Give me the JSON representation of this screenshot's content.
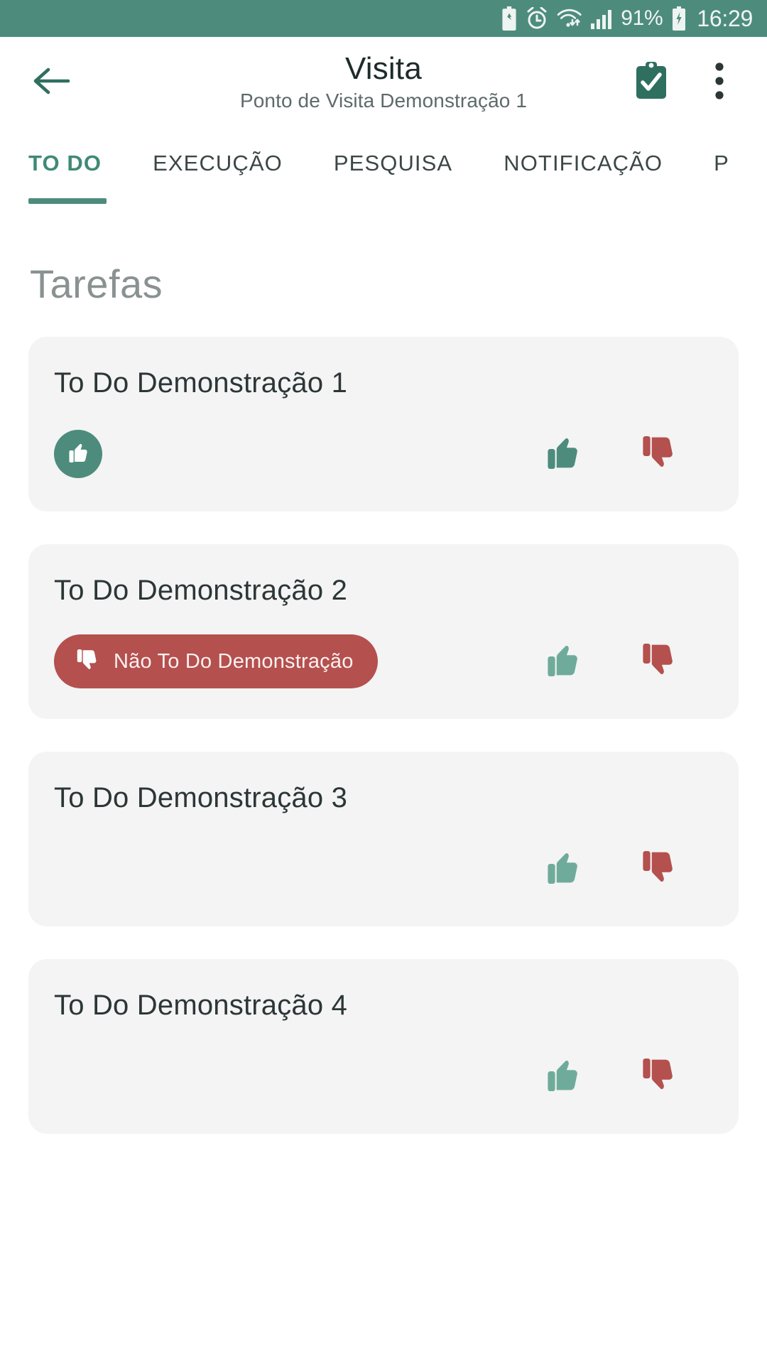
{
  "status_bar": {
    "battery_percent": "91%",
    "clock": "16:29",
    "icons": [
      "battery-saver-icon",
      "alarm-clock-icon",
      "wifi-icon",
      "signal-bars-icon",
      "battery-charging-icon"
    ],
    "background_color": "#4d8c7d"
  },
  "appbar": {
    "back_icon": "arrow-left-icon",
    "title": "Visita",
    "subtitle": "Ponto de Visita Demonstração 1",
    "clipboard_icon": "clipboard-check-icon",
    "overflow_icon": "more-vertical-icon"
  },
  "tabs": {
    "items": [
      {
        "label": "TO DO",
        "active": true
      },
      {
        "label": "EXECUÇÃO",
        "active": false
      },
      {
        "label": "PESQUISA",
        "active": false
      },
      {
        "label": "NOTIFICAÇÃO",
        "active": false
      },
      {
        "label": "P",
        "active": false
      }
    ],
    "active_color": "#3f8a77",
    "indicator_color": "#4d8c7d"
  },
  "main": {
    "section_title": "Tarefas",
    "tasks": [
      {
        "title": "To Do Demonstração 1",
        "status_badge": {
          "type": "circle",
          "icon": "thumbs-up-icon",
          "color": "#4d8c7d"
        },
        "thumbs_up_icon": "thumbs-up-icon",
        "thumbs_down_icon": "thumbs-down-icon"
      },
      {
        "title": "To Do Demonstração 2",
        "status_badge": {
          "type": "chip",
          "icon": "thumbs-down-icon",
          "label": "Não To Do Demonstração",
          "color": "#b4504e"
        },
        "thumbs_up_icon": "thumbs-up-icon",
        "thumbs_down_icon": "thumbs-down-icon"
      },
      {
        "title": "To Do Demonstração 3",
        "status_badge": null,
        "thumbs_up_icon": "thumbs-up-icon",
        "thumbs_down_icon": "thumbs-down-icon"
      },
      {
        "title": "To Do Demonstração 4",
        "status_badge": null,
        "thumbs_up_icon": "thumbs-up-icon",
        "thumbs_down_icon": "thumbs-down-icon"
      }
    ]
  },
  "colors": {
    "accent_teal": "#4d8c7d",
    "danger_red": "#b4504e",
    "card_bg": "#f4f4f4"
  }
}
